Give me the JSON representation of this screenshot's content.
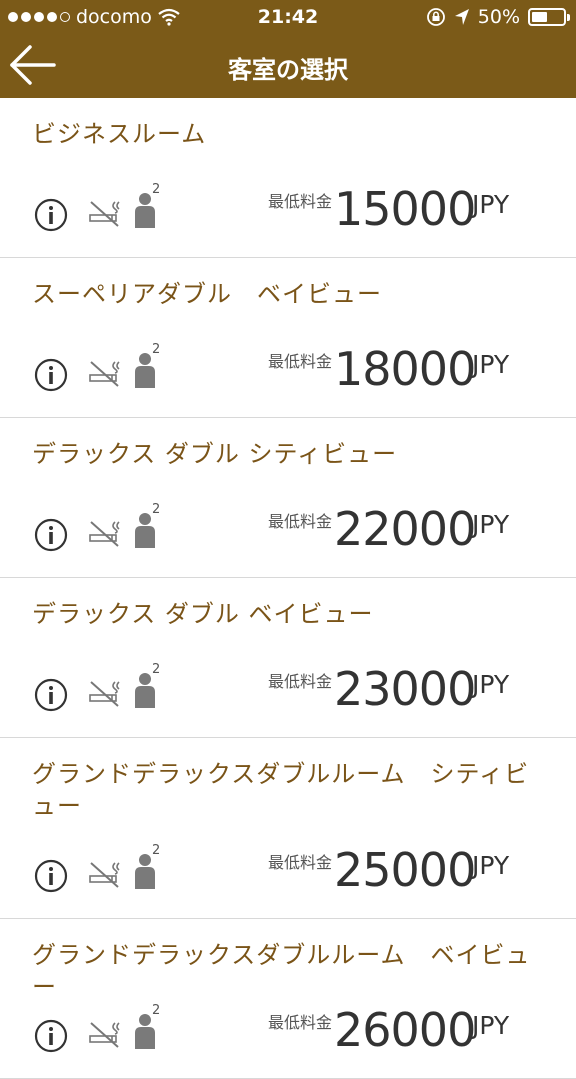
{
  "status_bar": {
    "carrier": "docomo",
    "time": "21:42",
    "battery": "50%",
    "battery_level": 0.5,
    "signal_bars": 4
  },
  "nav": {
    "title": "客室の選択",
    "back_icon": "arrow-left-icon"
  },
  "colors": {
    "header_bg": "#7b5a18",
    "room_name": "#7a5418",
    "price": "#333333"
  },
  "rooms": [
    {
      "name": "ビジネスルーム",
      "price_label": "最低料金",
      "price": "15000",
      "currency": "JPY",
      "guests": "2"
    },
    {
      "name": "スーペリアダブル　ベイビュー",
      "price_label": "最低料金",
      "price": "18000",
      "currency": "JPY",
      "guests": "2"
    },
    {
      "name": "デラックス ダブル シティビュー",
      "price_label": "最低料金",
      "price": "22000",
      "currency": "JPY",
      "guests": "2"
    },
    {
      "name": "デラックス ダブル ベイビュー",
      "price_label": "最低料金",
      "price": "23000",
      "currency": "JPY",
      "guests": "2"
    },
    {
      "name": "グランドデラックスダブルルーム　シティビュー",
      "price_label": "最低料金",
      "price": "25000",
      "currency": "JPY",
      "guests": "2"
    },
    {
      "name": "グランドデラックスダブルルーム　ベイビュー",
      "price_label": "最低料金",
      "price": "26000",
      "currency": "JPY",
      "guests": "2"
    }
  ]
}
